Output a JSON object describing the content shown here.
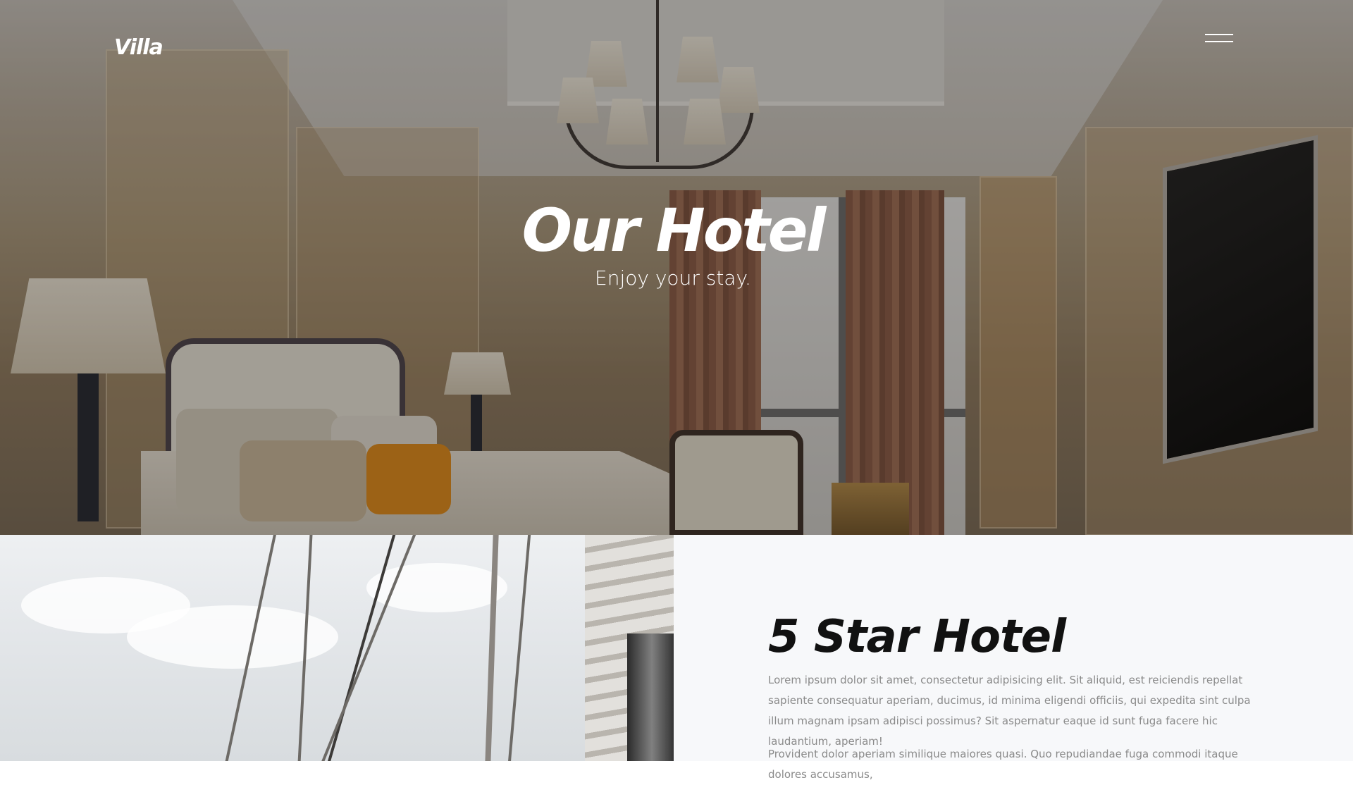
{
  "header": {
    "logo": "Villa",
    "menu_icon": "hamburger-menu-icon"
  },
  "hero": {
    "title": "Our Hotel",
    "subtitle": "Enjoy your stay."
  },
  "feature": {
    "title": "5 Star Hotel",
    "paragraphs": [
      "Lorem ipsum dolor sit amet, consectetur adipisicing elit. Sit aliquid, est reiciendis repellat sapiente consequatur aperiam, ducimus, id minima eligendi officiis, qui expedita sint culpa illum magnam ipsam adipisci possimus? Sit aspernatur eaque id sunt fuga facere hic laudantium, aperiam!",
      "Provident dolor aperiam similique maiores quasi. Quo repudiandae fuga commodi itaque dolores accusamus,"
    ]
  },
  "colors": {
    "hero_overlay": "#19161459",
    "panel_background": "#f7f8fa",
    "title_text": "#111111",
    "body_text": "#8a8a8a",
    "header_text": "#ffffff"
  }
}
